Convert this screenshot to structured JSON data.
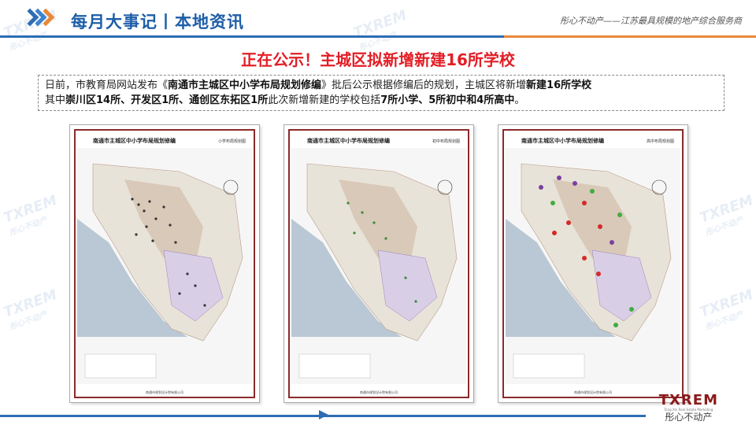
{
  "header": {
    "title": "每月大事记丨本地资讯",
    "tagline": "彤心不动产——江苏最具规模的地产综合服务商"
  },
  "headline": "正在公示！主城区拟新增新建16所学校",
  "body": {
    "p1": "日前，市教育局网站发布《",
    "doc_title": "南通市主城区中小学布局规划修编",
    "p2": "》批后公示根据修编后的规划，主城区将新增",
    "p3": "新建16所学校",
    "p4": "其中",
    "p5": "崇川区14所、开发区1所、通创区东拓区1所",
    "p6": "此次新增新建的学校包括",
    "p7": "7所小学、5所初中和4所高中",
    "p8": "。"
  },
  "maps": [
    {
      "title": "南通市主城区中小学布局规划修编",
      "subtitle": "小学布局规划图",
      "footer": "南通市规划设计院有限公司"
    },
    {
      "title": "南通市主城区中小学布局规划修编",
      "subtitle": "初中布局规划图",
      "footer": "南通市规划设计院有限公司"
    },
    {
      "title": "南通市主城区中小学布局规划修编",
      "subtitle": "高中布局规划图",
      "footer": "南通市规划设计院有限公司"
    }
  ],
  "watermark": {
    "brand": "TXREM",
    "cn": "彤心不动产"
  },
  "logo": {
    "brand": "TXREM",
    "en": "Tong Xin Real Estate Marketing",
    "cn": "彤心不动产"
  },
  "colors": {
    "primary": "#2e6db4",
    "accent": "#e9893a",
    "headline": "#e21e26",
    "map_border": "#8b2a2a"
  }
}
